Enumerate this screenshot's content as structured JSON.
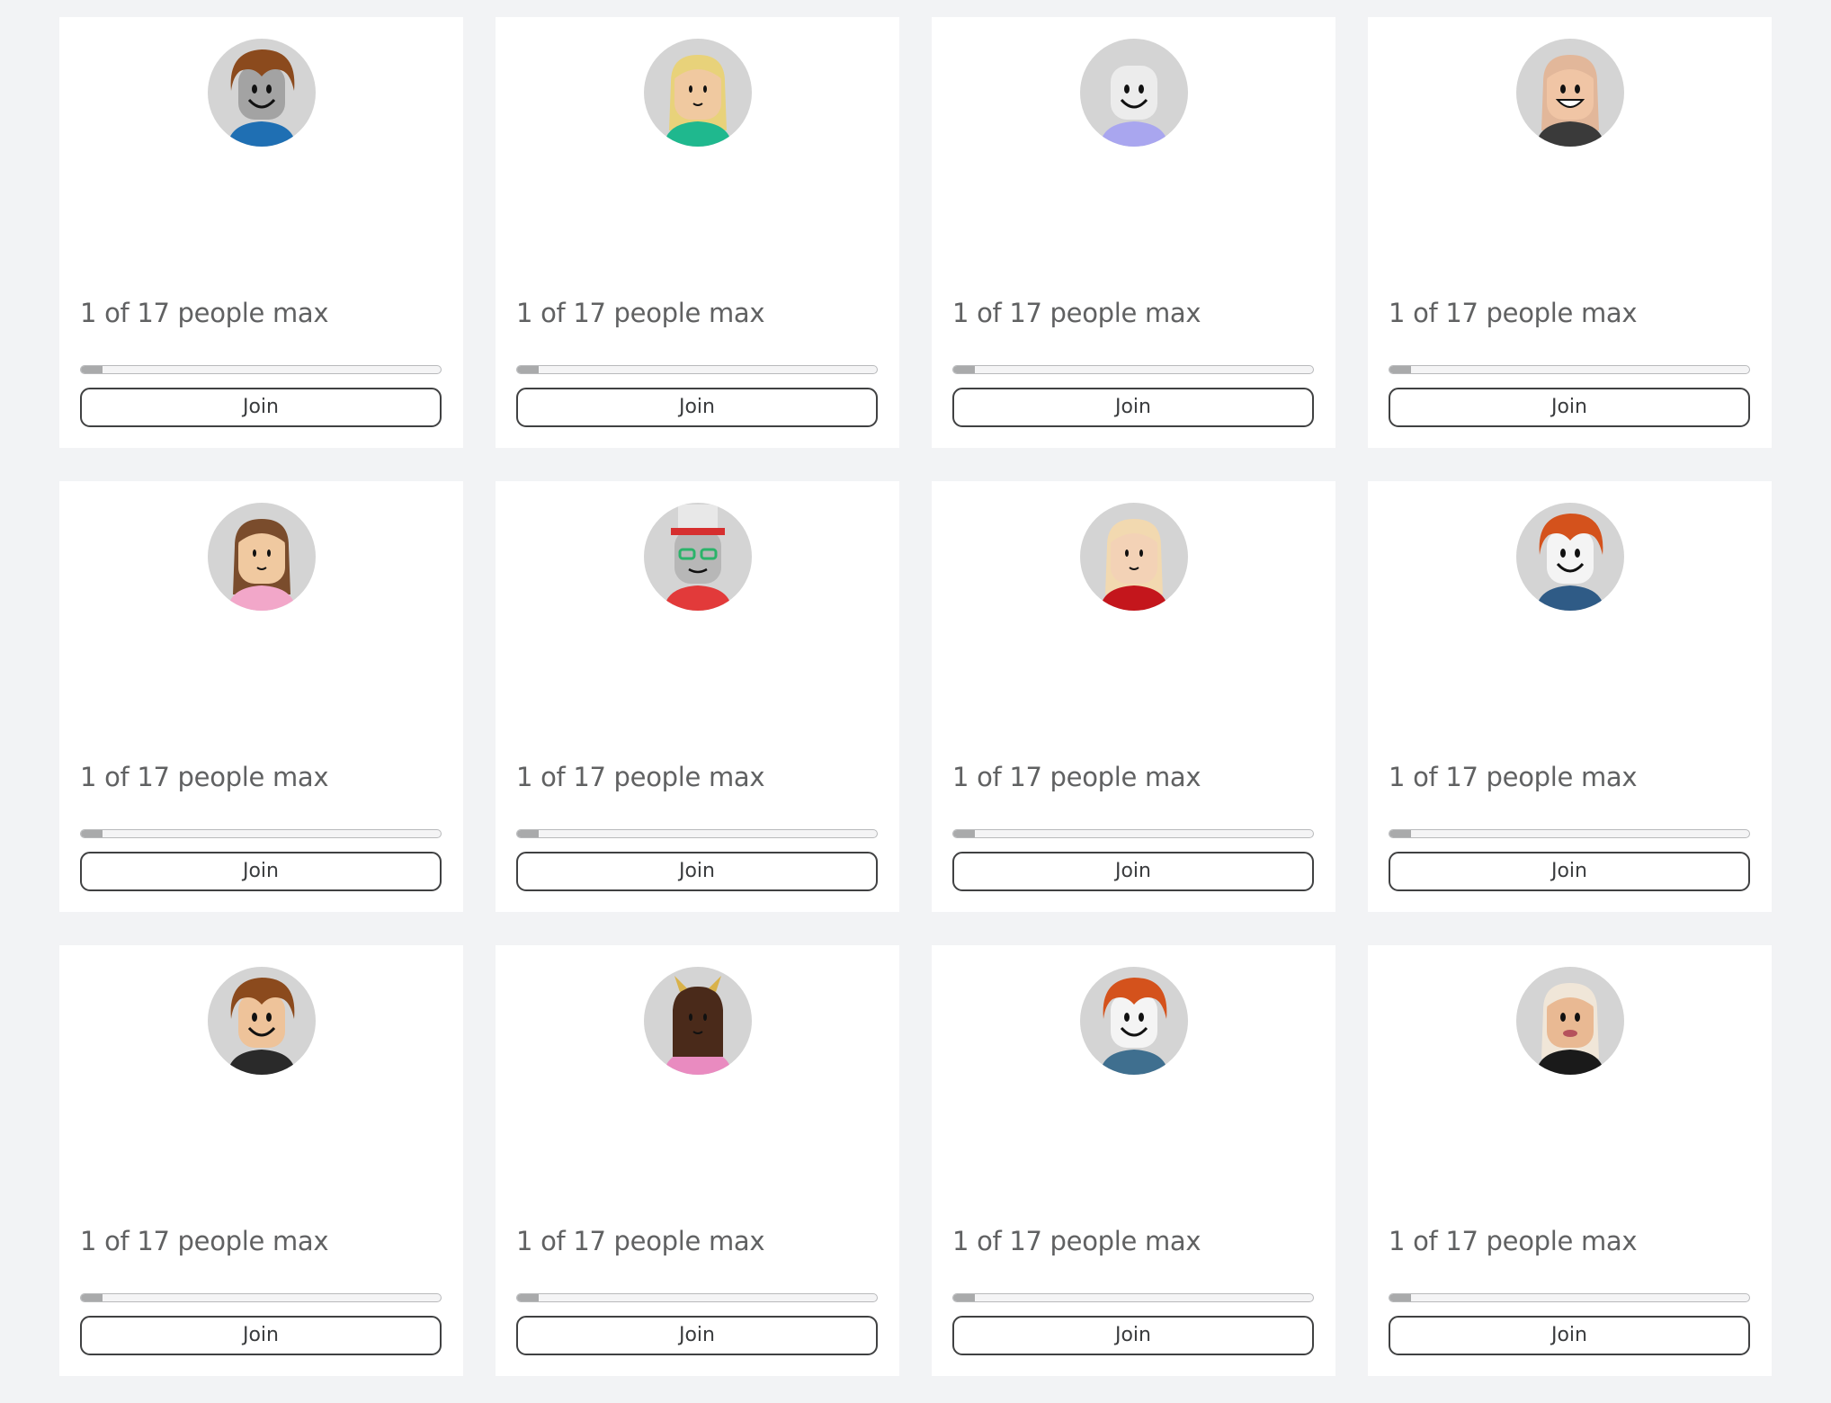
{
  "servers": [
    {
      "capacity_text": "1 of 17 people max",
      "fill_fraction": 0.0588,
      "join_label": "Join",
      "avatar": {
        "hair": "#8b4a1d",
        "skin": "#a3a3a3",
        "shirt": "#1f6fb3",
        "face": "smile",
        "hair_style": "short"
      }
    },
    {
      "capacity_text": "1 of 17 people max",
      "fill_fraction": 0.0588,
      "join_label": "Join",
      "avatar": {
        "hair": "#e8d27a",
        "skin": "#f0c9a0",
        "shirt": "#1fb88e",
        "face": "small",
        "hair_style": "long"
      }
    },
    {
      "capacity_text": "1 of 17 people max",
      "fill_fraction": 0.0588,
      "join_label": "Join",
      "avatar": {
        "hair": "#ececec",
        "skin": "#ececec",
        "shirt": "#a9a6ef",
        "face": "smile",
        "hair_style": "none"
      }
    },
    {
      "capacity_text": "1 of 17 people max",
      "fill_fraction": 0.0588,
      "join_label": "Join",
      "avatar": {
        "hair": "#e2b79a",
        "skin": "#f0c5a5",
        "shirt": "#3a3a3a",
        "face": "grin",
        "hair_style": "long"
      }
    },
    {
      "capacity_text": "1 of 17 people max",
      "fill_fraction": 0.0588,
      "join_label": "Join",
      "avatar": {
        "hair": "#7a4c2c",
        "skin": "#f0c9a0",
        "shirt": "#f2a7c9",
        "face": "small",
        "hair_style": "long"
      }
    },
    {
      "capacity_text": "1 of 17 people max",
      "fill_fraction": 0.0588,
      "join_label": "Join",
      "avatar": {
        "hair": "#e8e8e8",
        "skin": "#b7b7b7",
        "shirt": "#e23a3a",
        "face": "glasses",
        "hair_style": "hat"
      }
    },
    {
      "capacity_text": "1 of 17 people max",
      "fill_fraction": 0.0588,
      "join_label": "Join",
      "avatar": {
        "hair": "#f2d9b0",
        "skin": "#f3d2b6",
        "shirt": "#c4161c",
        "face": "small",
        "hair_style": "long"
      }
    },
    {
      "capacity_text": "1 of 17 people max",
      "fill_fraction": 0.0588,
      "join_label": "Join",
      "avatar": {
        "hair": "#d4521c",
        "skin": "#f4f4f4",
        "shirt": "#2f5b86",
        "face": "smile",
        "hair_style": "short"
      }
    },
    {
      "capacity_text": "1 of 17 people max",
      "fill_fraction": 0.0588,
      "join_label": "Join",
      "avatar": {
        "hair": "#8b4a1d",
        "skin": "#eec39a",
        "shirt": "#2a2a2a",
        "face": "smile",
        "hair_style": "short"
      }
    },
    {
      "capacity_text": "1 of 17 people max",
      "fill_fraction": 0.0588,
      "join_label": "Join",
      "avatar": {
        "hair": "#4a2a1a",
        "skin": "#7b4a33",
        "shirt": "#e98bc0",
        "face": "small",
        "hair_style": "horns"
      }
    },
    {
      "capacity_text": "1 of 17 people max",
      "fill_fraction": 0.0588,
      "join_label": "Join",
      "avatar": {
        "hair": "#d4521c",
        "skin": "#f4f4f4",
        "shirt": "#3f6f8f",
        "face": "smile",
        "hair_style": "short"
      }
    },
    {
      "capacity_text": "1 of 17 people max",
      "fill_fraction": 0.0588,
      "join_label": "Join",
      "avatar": {
        "hair": "#f0e6d8",
        "skin": "#e9b993",
        "shirt": "#1a1a1a",
        "face": "lips",
        "hair_style": "long"
      }
    }
  ]
}
